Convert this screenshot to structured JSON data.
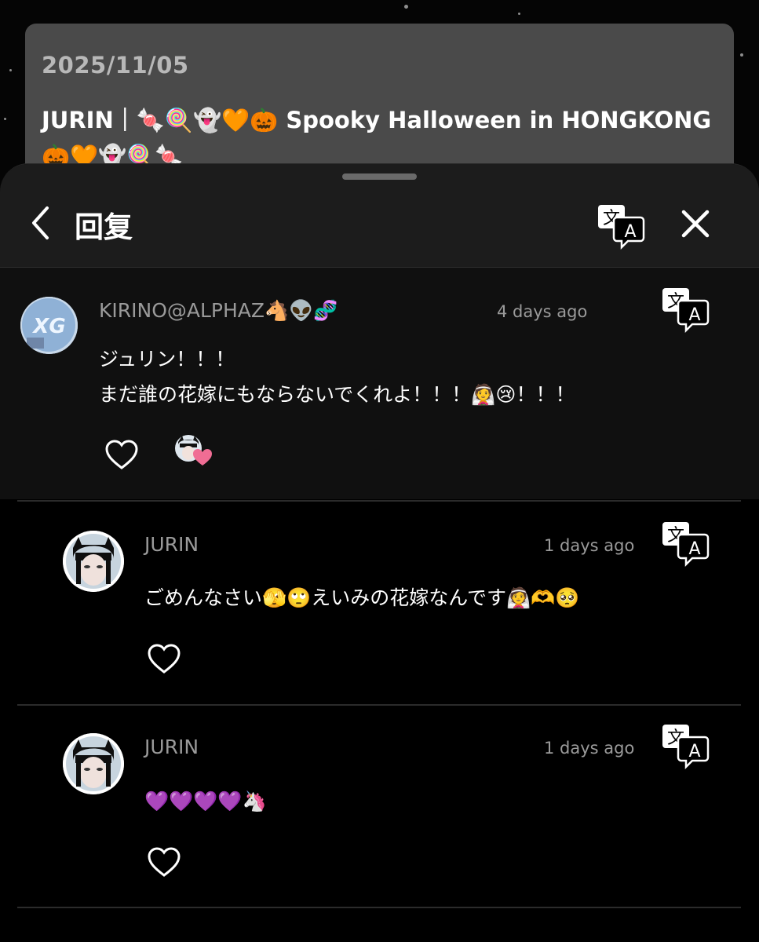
{
  "post": {
    "date": "2025/11/05",
    "title": "JURIN｜🍬🍭👻🧡🎃 Spooky Halloween in HONGKONG 🎃🧡👻🍭🍬"
  },
  "sheet": {
    "title": "回复",
    "translate_icon": "translate-icon",
    "close_icon": "close-icon",
    "back_icon": "chevron-left-icon"
  },
  "comments": [
    {
      "user": "KIRINO@ALPHAZ🐴👽🧬",
      "time": "4 days ago",
      "text": "ジュリン！！！\nまだ誰の花嫁にもならないでくれよ！！！👰😢！！！",
      "liked_by_author": true
    },
    {
      "user": "JURIN",
      "time": "1 days ago",
      "text": "ごめんなさい🫣🙄えいみの花嫁なんです👰🫶🥺"
    },
    {
      "user": "JURIN",
      "time": "1 days ago",
      "text": "💜💜💜💜🦄"
    }
  ],
  "colors": {
    "sheet_bg": "#000000",
    "header_bg": "#1c1c1c",
    "root_comment_bg": "#101010",
    "muted_text": "#9a9a9a",
    "heart_badge": "#f06d94"
  }
}
